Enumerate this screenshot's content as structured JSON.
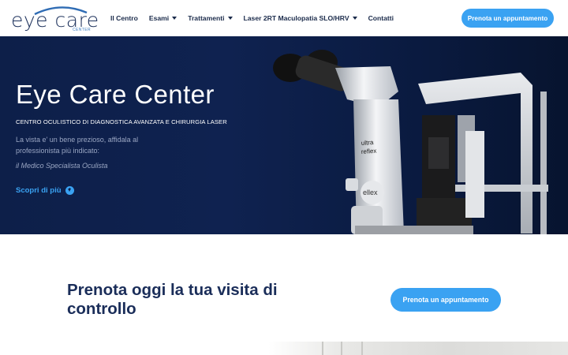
{
  "logo": {
    "text": "eye care",
    "subtext": "CENTER"
  },
  "nav": {
    "items": [
      {
        "label": "Il Centro",
        "dropdown": false
      },
      {
        "label": "Esami",
        "dropdown": true
      },
      {
        "label": "Trattamenti",
        "dropdown": true
      },
      {
        "label": "Laser 2RT Maculopatia SLO/HRV",
        "dropdown": true
      },
      {
        "label": "Contatti",
        "dropdown": false
      }
    ],
    "cta_label": "Prenota un appuntamento"
  },
  "hero": {
    "title": "Eye Care Center",
    "subtitle": "CENTRO OCULISTICO DI DIAGNOSTICA AVANZATA E CHIRURGIA LASER",
    "text": "La vista e' un bene prezioso, affidala al professionista più indicato:",
    "quote": "il Medico Specialista Oculista",
    "link_label": "Scopri di più",
    "image_labels": {
      "brand_line1": "ultra",
      "brand_line2": "reflex",
      "badge": "ellex"
    }
  },
  "booking": {
    "title": "Prenota oggi la tua visita di controllo",
    "button_label": "Prenota un appuntamento"
  },
  "colors": {
    "accent": "#3aa2f2",
    "navy": "#0d1f49",
    "heading": "#1a2d59"
  }
}
